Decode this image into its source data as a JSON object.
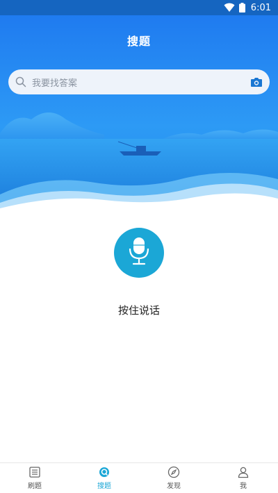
{
  "status_bar": {
    "time": "6:01"
  },
  "header": {
    "title": "搜题"
  },
  "search": {
    "placeholder": "我要找答案"
  },
  "voice": {
    "label": "按住说话"
  },
  "tabbar": {
    "active_index": 1,
    "items": [
      {
        "label": "刷题",
        "icon": "list-icon"
      },
      {
        "label": "搜题",
        "icon": "search-tab-icon"
      },
      {
        "label": "发现",
        "icon": "compass-icon"
      },
      {
        "label": "我",
        "icon": "user-icon"
      }
    ]
  },
  "colors": {
    "accent": "#1ba7d6",
    "hero_top": "#1e7df0",
    "status_bar": "#1565c0"
  }
}
